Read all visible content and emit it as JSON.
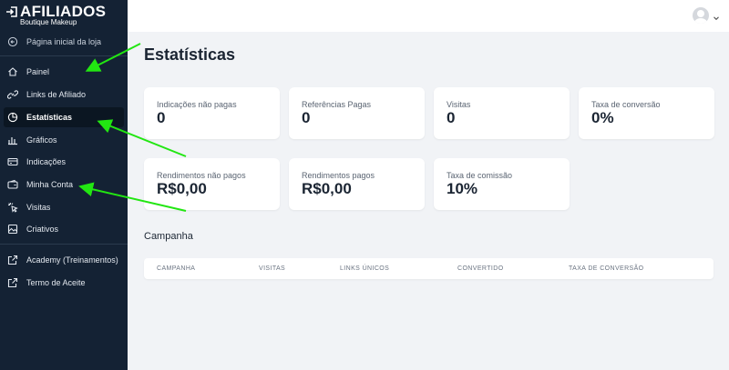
{
  "brand": {
    "title": "AFILIADOS",
    "subtitle": "Boutique Makeup"
  },
  "sidebar": {
    "home_link": "Página inicial da loja",
    "items": [
      {
        "label": "Painel",
        "icon": "home-icon"
      },
      {
        "label": "Links de Afiliado",
        "icon": "link-icon"
      },
      {
        "label": "Estatísticas",
        "icon": "pie-chart-icon",
        "active": true
      },
      {
        "label": "Gráficos",
        "icon": "bar-chart-icon"
      },
      {
        "label": "Indicações",
        "icon": "credit-card-icon"
      },
      {
        "label": "Minha Conta",
        "icon": "wallet-icon"
      },
      {
        "label": "Visitas",
        "icon": "click-icon"
      },
      {
        "label": "Criativos",
        "icon": "creative-icon"
      }
    ],
    "external": [
      {
        "label": "Academy (Treinamentos)",
        "icon": "external-link-icon"
      },
      {
        "label": "Termo de Aceite",
        "icon": "external-link-icon"
      }
    ]
  },
  "main": {
    "title": "Estatísticas",
    "stats_row1": [
      {
        "label": "Indicações não pagas",
        "value": "0"
      },
      {
        "label": "Referências Pagas",
        "value": "0"
      },
      {
        "label": "Visitas",
        "value": "0"
      },
      {
        "label": "Taxa de conversão",
        "value": "0%"
      }
    ],
    "stats_row2": [
      {
        "label": "Rendimentos não pagos",
        "value": "R$0,00"
      },
      {
        "label": "Rendimentos pagos",
        "value": "R$0,00"
      },
      {
        "label": "Taxa de comissão",
        "value": "10%"
      }
    ],
    "campaign": {
      "title": "Campanha",
      "columns": [
        "CAMPANHA",
        "VISITAS",
        "LINKS ÚNICOS",
        "CONVERTIDO",
        "TAXA DE CONVERSÃO"
      ]
    }
  },
  "colors": {
    "sidebar_bg": "#142234",
    "sidebar_active": "#0b1622",
    "page_bg": "#f1f3f6",
    "annotation_arrow": "#22e612"
  }
}
